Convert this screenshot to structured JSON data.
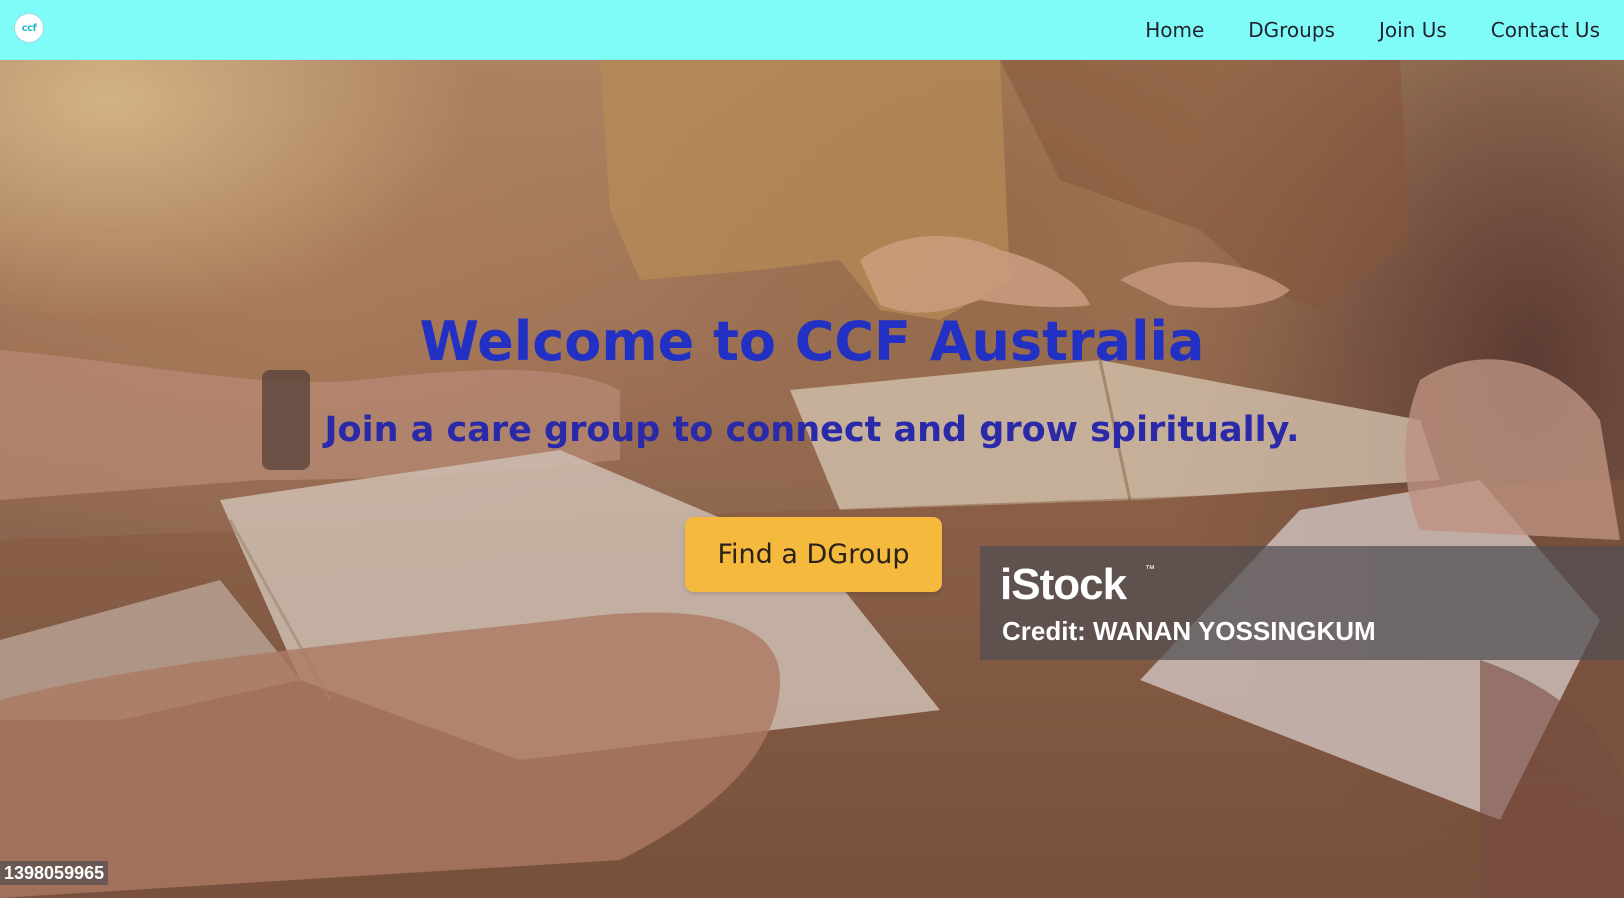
{
  "header": {
    "logo_text": "ccf",
    "nav": [
      {
        "label": "Home"
      },
      {
        "label": "DGroups"
      },
      {
        "label": "Join Us"
      },
      {
        "label": "Contact Us"
      }
    ]
  },
  "hero": {
    "title": "Welcome to CCF Australia",
    "subtitle": "Join a care group to connect and grow spiritually.",
    "cta_label": "Find a DGroup"
  },
  "watermark": {
    "brand": "iStock",
    "trademark": "™",
    "credit": "Credit: WANAN YOSSINGKUM",
    "image_id": "1398059965"
  },
  "colors": {
    "navbar_bg": "#7ffcf8",
    "title_color": "#2230c4",
    "cta_bg": "#f5b93e"
  }
}
